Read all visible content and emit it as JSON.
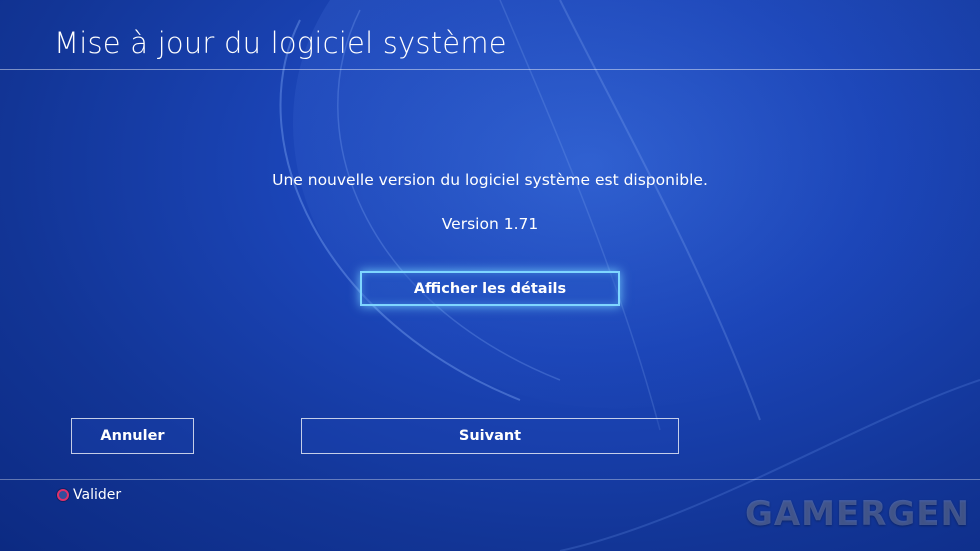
{
  "header": {
    "title": "Mise à jour du logiciel système"
  },
  "main": {
    "message": "Une nouvelle version du logiciel système est disponible.",
    "version": "Version 1.71",
    "details_button": "Afficher les détails"
  },
  "actions": {
    "cancel_label": "Annuler",
    "next_label": "Suivant"
  },
  "footer": {
    "hint_icon": "circle-button-icon",
    "hint_label": "Valider"
  },
  "watermark": "GAMERGEN",
  "colors": {
    "background": "#1b45b8",
    "focus_glow": "#7fd6ff",
    "circle_button": "#e0306a"
  }
}
